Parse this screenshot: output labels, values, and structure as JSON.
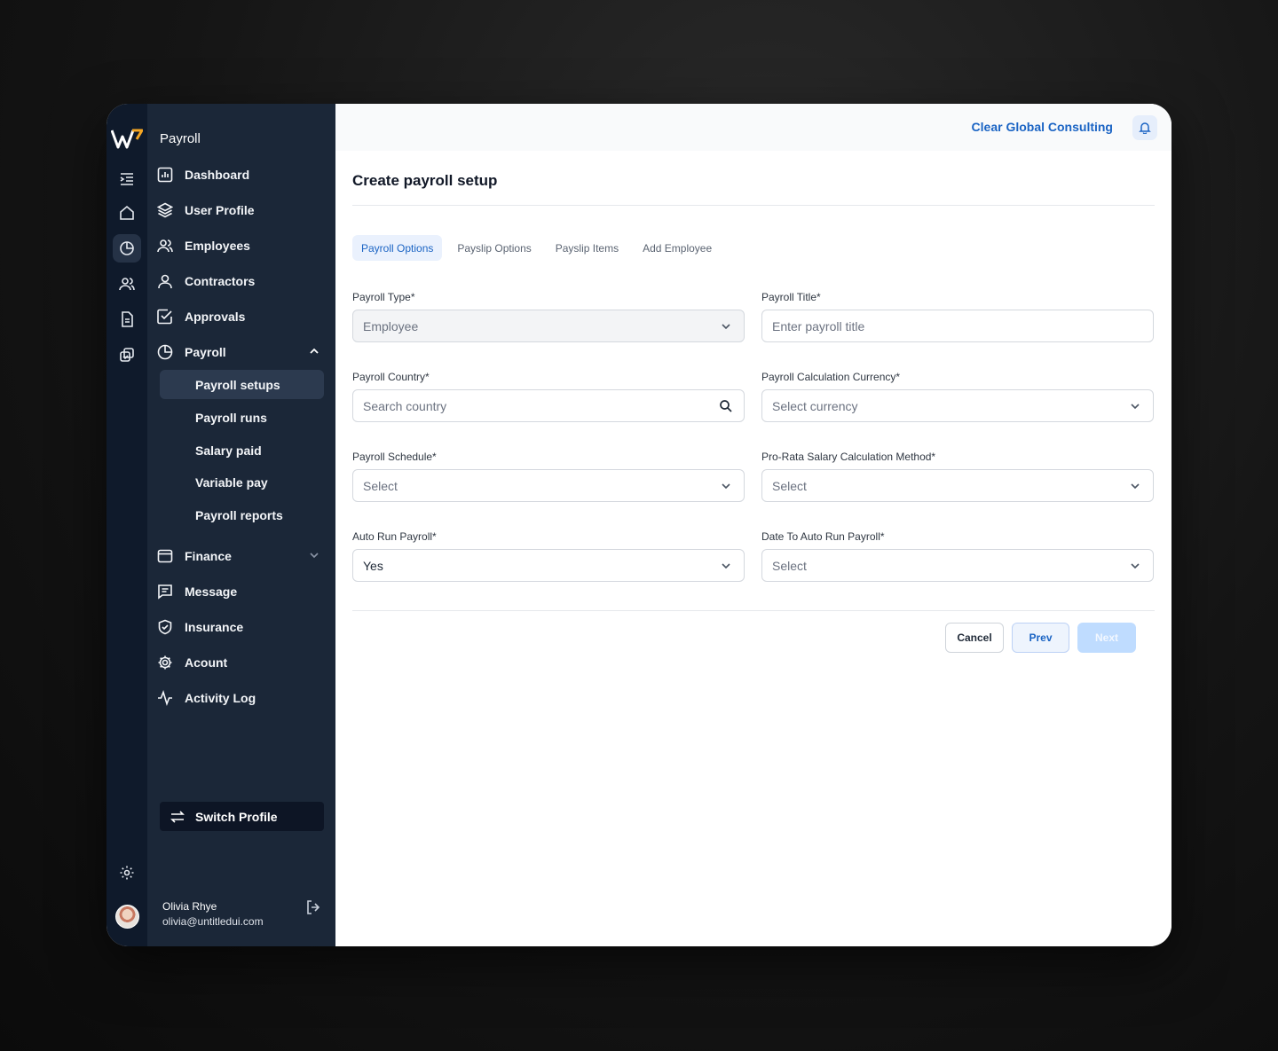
{
  "sidebar": {
    "title": "Payroll",
    "items": [
      {
        "label": "Dashboard",
        "icon": "bar-chart-icon"
      },
      {
        "label": "User Profile",
        "icon": "layers-icon"
      },
      {
        "label": "Employees",
        "icon": "users-icon"
      },
      {
        "label": "Contractors",
        "icon": "user-icon"
      },
      {
        "label": "Approvals",
        "icon": "check-square-icon"
      },
      {
        "label": "Payroll",
        "icon": "pie-chart-icon"
      }
    ],
    "payroll_sub": [
      {
        "label": "Payroll setups",
        "active": true
      },
      {
        "label": "Payroll runs"
      },
      {
        "label": "Salary paid"
      },
      {
        "label": "Variable pay"
      },
      {
        "label": "Payroll reports"
      }
    ],
    "items_bottom": [
      {
        "label": "Finance",
        "icon": "wallet-icon"
      },
      {
        "label": "Message",
        "icon": "message-icon"
      },
      {
        "label": "Insurance",
        "icon": "shield-icon"
      },
      {
        "label": "Acount",
        "icon": "gear-icon"
      },
      {
        "label": "Activity Log",
        "icon": "activity-icon"
      }
    ],
    "switch_profile": "Switch Profile",
    "user": {
      "name": "Olivia Rhye",
      "email": "olivia@untitledui.com"
    }
  },
  "header": {
    "company": "Clear Global Consulting"
  },
  "page": {
    "title": "Create payroll setup"
  },
  "tabs": [
    {
      "label": "Payroll Options",
      "active": true
    },
    {
      "label": "Payslip Options"
    },
    {
      "label": "Payslip Items"
    },
    {
      "label": "Add Employee"
    }
  ],
  "form": {
    "payroll_type": {
      "label": "Payroll Type*",
      "value": "Employee"
    },
    "payroll_title": {
      "label": "Payroll Title*",
      "placeholder": "Enter payroll title"
    },
    "payroll_country": {
      "label": "Payroll Country*",
      "placeholder": "Search country"
    },
    "calc_currency": {
      "label": "Payroll Calculation Currency*",
      "placeholder": "Select currency"
    },
    "schedule": {
      "label": "Payroll Schedule*",
      "placeholder": "Select"
    },
    "prorata": {
      "label": "Pro-Rata Salary Calculation Method*",
      "placeholder": "Select"
    },
    "auto_run": {
      "label": "Auto Run Payroll*",
      "value": "Yes"
    },
    "auto_run_date": {
      "label": "Date To Auto Run Payroll*",
      "placeholder": "Select"
    }
  },
  "actions": {
    "cancel": "Cancel",
    "prev": "Prev",
    "next": "Next"
  },
  "colors": {
    "accent": "#1b64c4",
    "sidebar": "#1b2738",
    "rail": "#0f1a2b"
  }
}
